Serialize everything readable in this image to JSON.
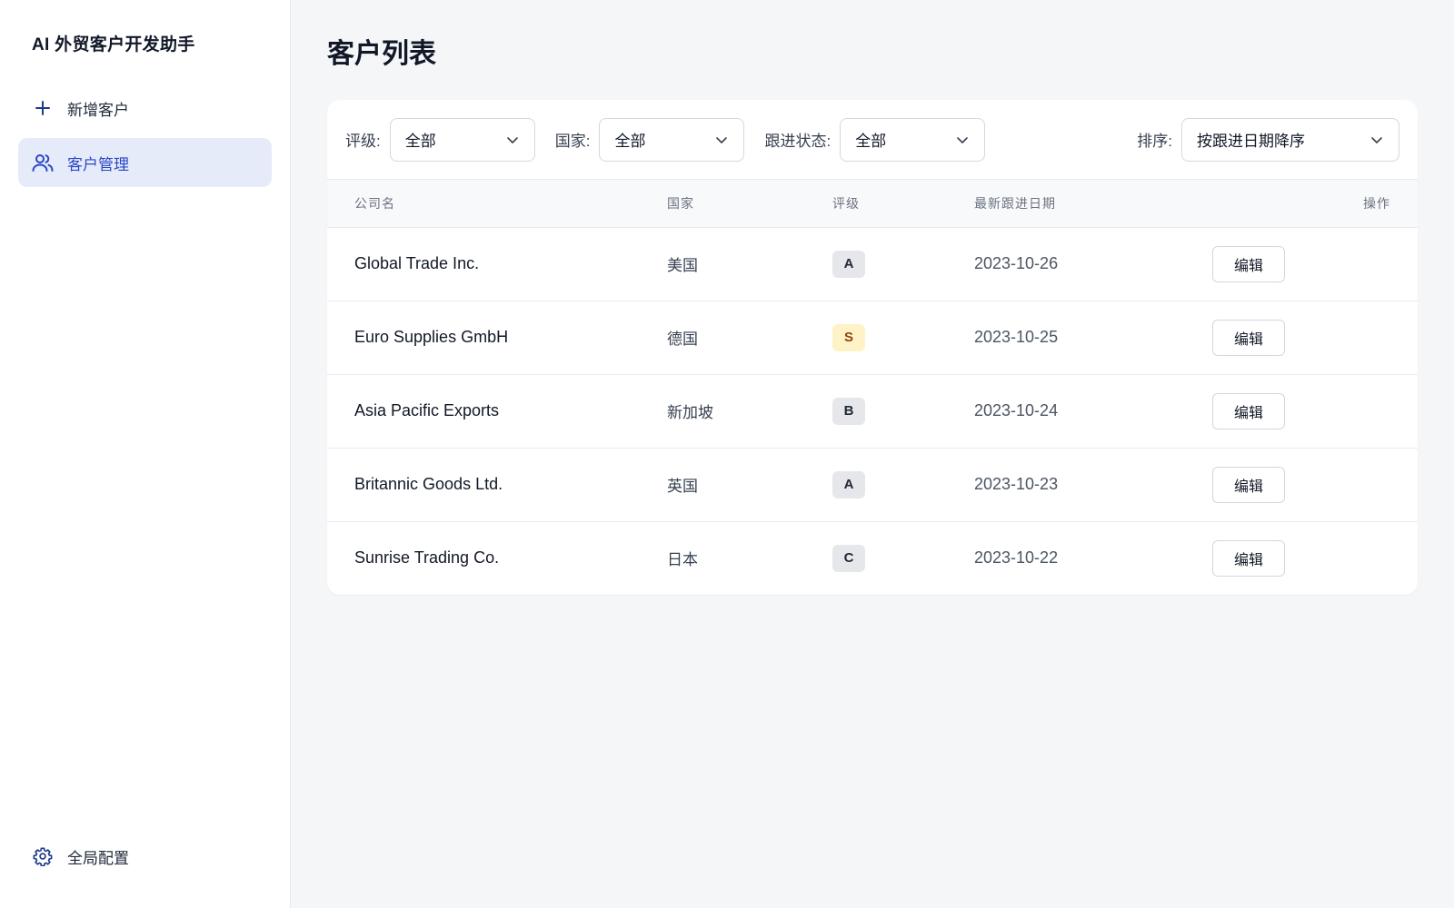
{
  "app": {
    "title": "AI 外贸客户开发助手"
  },
  "sidebar": {
    "items": [
      {
        "label": "新增客户",
        "icon": "plus-icon"
      },
      {
        "label": "客户管理",
        "icon": "users-icon",
        "active": true
      }
    ],
    "footer": {
      "label": "全局配置",
      "icon": "gear-icon"
    }
  },
  "page": {
    "title": "客户列表"
  },
  "filters": {
    "rating": {
      "label": "评级:",
      "value": "全部"
    },
    "country": {
      "label": "国家:",
      "value": "全部"
    },
    "status": {
      "label": "跟进状态:",
      "value": "全部"
    },
    "sort": {
      "label": "排序:",
      "value": "按跟进日期降序"
    }
  },
  "table": {
    "headers": {
      "company": "公司名",
      "country": "国家",
      "rating": "评级",
      "date": "最新跟进日期",
      "action": "操作"
    },
    "rows": [
      {
        "company": "Global Trade Inc.",
        "country": "美国",
        "rating": "A",
        "date": "2023-10-26",
        "action": "编辑"
      },
      {
        "company": "Euro Supplies GmbH",
        "country": "德国",
        "rating": "S",
        "date": "2023-10-25",
        "action": "编辑"
      },
      {
        "company": "Asia Pacific Exports",
        "country": "新加坡",
        "rating": "B",
        "date": "2023-10-24",
        "action": "编辑"
      },
      {
        "company": "Britannic Goods Ltd.",
        "country": "英国",
        "rating": "A",
        "date": "2023-10-23",
        "action": "编辑"
      },
      {
        "company": "Sunrise Trading Co.",
        "country": "日本",
        "rating": "C",
        "date": "2023-10-22",
        "action": "编辑"
      }
    ]
  },
  "colors": {
    "accent": "#2b46c7",
    "active_bg": "#e6ebfa",
    "badge_s_bg": "#fef3c7",
    "badge_bg": "#e5e7eb"
  }
}
